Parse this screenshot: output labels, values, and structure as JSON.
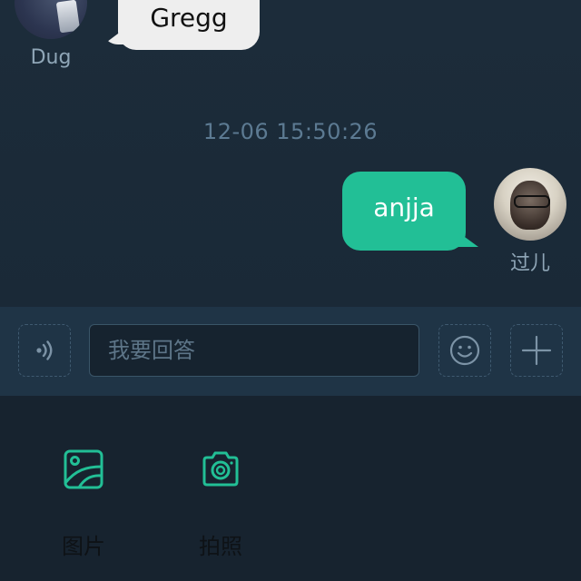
{
  "messages": [
    {
      "sender": "Dug",
      "text": "Gregg",
      "side": "left"
    },
    {
      "sender": "过儿",
      "text": "anjja",
      "side": "right"
    }
  ],
  "timestamp": "12-06 15:50:26",
  "input": {
    "placeholder": "我要回答",
    "value": ""
  },
  "attachments": [
    {
      "label": "图片",
      "icon": "image-icon"
    },
    {
      "label": "拍照",
      "icon": "camera-icon"
    }
  ],
  "icons": {
    "voice": "voice-icon",
    "emoji": "smiley-icon",
    "more": "plus-icon"
  },
  "colors": {
    "accent": "#22bf96",
    "chat_bg": "#1b2a38",
    "input_bar_bg": "#1f3446",
    "panel_bg": "#17232f",
    "incoming_bubble": "#eeeeee"
  }
}
